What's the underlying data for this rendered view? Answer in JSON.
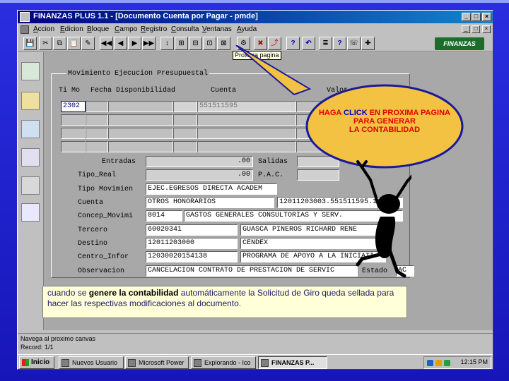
{
  "window": {
    "title": "FINANZAS PLUS 1.1 - [Documento Cuenta por Pagar - pmde]",
    "controls": {
      "minimize": "_",
      "maximize": "□",
      "close": "×"
    }
  },
  "menu": {
    "items": [
      "Accion",
      "Edicion",
      "Bloque",
      "Campo",
      "Registro",
      "Consulta",
      "Ventanas",
      "Ayuda"
    ]
  },
  "toolbar": {
    "tooltip": "Proxima pagina",
    "logo_text": "FINANZAS",
    "buttons": [
      "💾",
      "✂",
      "⧉",
      "📋",
      "✎",
      "◀◀",
      "◀",
      "▶",
      "▶▶",
      "↕",
      "⊞",
      "⊟",
      "⊡",
      "⊠",
      "✖",
      "?",
      "↶",
      "✚",
      "⤴",
      "≣",
      "?",
      "☏",
      "⚙"
    ]
  },
  "form": {
    "section_title": "Movimiento Ejecucion Presupuestal",
    "columns": {
      "tmov": "Ti Mo",
      "fecha": "Fecha Disponibilidad",
      "cuenta": "Cuenta",
      "valor": "Valor"
    },
    "rows": [
      {
        "tmov": "2302",
        "fecha": "",
        "cuenta": "551511595",
        "valor": ""
      },
      {
        "tmov": "",
        "fecha": "",
        "cuenta": "",
        "valor": ""
      },
      {
        "tmov": "",
        "fecha": "",
        "cuenta": "",
        "valor": ""
      },
      {
        "tmov": "",
        "fecha": "",
        "cuenta": "",
        "valor": ""
      }
    ],
    "entradas_label": "Entradas",
    "entradas_value": ".00",
    "salidas_label": "Salidas",
    "tipo_real_label": "Tipo_Real",
    "tipo_real_value": ".00",
    "pac_label": "P.A.C.",
    "tipo_mov_label": "Tipo Movimien",
    "tipo_mov_value": "EJEC.EGRESOS DIRECTA ACADEM",
    "cuenta_label": "Cuenta",
    "cuenta_value": "OTROS HONORARIOS",
    "cuenta_code": "12011203003.551511595.11030",
    "concep_label": "Concep_Movimi",
    "concep_code": "8014",
    "concep_value": "GASTOS GENERALES CONSULTORIAS Y SERV.",
    "tercero_label": "Tercero",
    "tercero_code": "60020341",
    "tercero_value": "GUASCA PINEROS RICHARD RENE",
    "destino_label": "Destino",
    "destino_code": "12011203000",
    "destino_value": "CENDEX",
    "centro_label": "Centro_Infor",
    "centro_code": "12030020154138",
    "centro_value": "PROGRAMA DE APOYO A LA INICIATI",
    "obs_label": "Observacion",
    "obs_value": "CANCELACION CONTRATO DE PRESTACION DE SERVIC",
    "estado_label": "Estado",
    "estado_value": "AC"
  },
  "note": {
    "prefix": "cuando se",
    "bold": "genere la contabilidad",
    "rest": "automáticamente la Solicitud de Giro queda sellada para hacer las respectivas modificaciones al documento."
  },
  "callout": {
    "line1_a": "HAGA",
    "line1_b": "CLICK",
    "line1_c": "EN PROXIMA PAGINA",
    "line2": "PARA GENERAR",
    "line3": "LA CONTABILIDAD",
    "fill": "#f4c242",
    "stroke": "#1a1a9a"
  },
  "status": {
    "line1": "Navega al proximo canvas",
    "line2": "Record: 1/1"
  },
  "taskbar": {
    "start": "Inicio",
    "tasks": [
      "Nuevos Usuario",
      "Microsoft Power",
      "Explorando - Ico",
      "FINANZAS P..."
    ],
    "clock": "12:15 PM"
  }
}
